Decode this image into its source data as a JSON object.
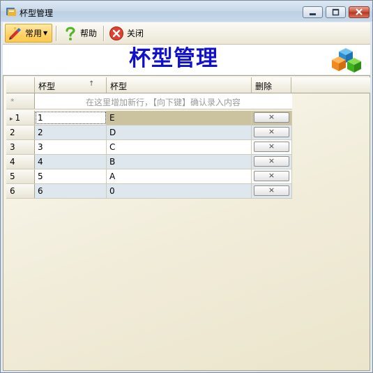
{
  "window": {
    "title": "杯型管理"
  },
  "toolbar": {
    "common_label": "常用",
    "help_label": "帮助",
    "close_label": "关闭"
  },
  "header": {
    "title": "杯型管理"
  },
  "grid": {
    "columns": [
      "杯型",
      "杯型",
      "删除"
    ],
    "sort_indicator": "↑",
    "new_row_marker": "*",
    "new_row_hint": "在这里增加新行，【向下键】确认录入内容",
    "current_row_marker": "▸",
    "delete_glyph": "×",
    "rows": [
      {
        "num": "1",
        "col1": "1",
        "col2": "E"
      },
      {
        "num": "2",
        "col1": "2",
        "col2": "D"
      },
      {
        "num": "3",
        "col1": "3",
        "col2": "C"
      },
      {
        "num": "4",
        "col1": "4",
        "col2": "B"
      },
      {
        "num": "5",
        "col1": "5",
        "col2": "A"
      },
      {
        "num": "6",
        "col1": "6",
        "col2": "0"
      }
    ]
  }
}
